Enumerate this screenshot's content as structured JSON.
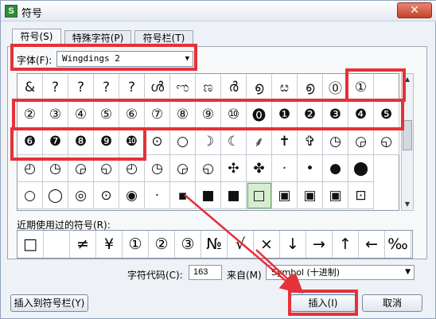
{
  "window": {
    "app_icon_letter": "S",
    "title": "符号",
    "close_glyph": "✕"
  },
  "tabs": [
    {
      "label": "符号(S)"
    },
    {
      "label": "特殊字符(P)"
    },
    {
      "label": "符号栏(T)"
    }
  ],
  "font": {
    "label": "字体(F):",
    "value": "Wingdings 2",
    "arrow": "▼"
  },
  "grid": {
    "rows": [
      [
        "&",
        "?",
        "?",
        "?",
        "?",
        "ൾ",
        "ಌ",
        "ಣ",
        "ർ",
        "൭",
        "ೞ",
        "൭",
        "⓪",
        "①"
      ],
      [
        "②",
        "③",
        "④",
        "⑤",
        "⑥",
        "⑦",
        "⑧",
        "⑨",
        "⑩",
        "⓿",
        "❶",
        "❷",
        "❸",
        "❹",
        "❺"
      ],
      [
        "❻",
        "❼",
        "❽",
        "❾",
        "❿",
        "⊙",
        "○",
        "☽",
        "☾",
        "⸙",
        "✝",
        "✞",
        "◷",
        "◶",
        "◵"
      ],
      [
        "◴",
        "◷",
        "◶",
        "◵",
        "◴",
        "◷",
        "◶",
        "◵",
        "✣",
        "✤",
        "·",
        "•",
        "●",
        "⬤"
      ],
      [
        "○",
        "◯",
        "◎",
        "⊙",
        "◉",
        "·",
        "▪",
        "■",
        "■",
        "□",
        "▣",
        "▣",
        "▣",
        "⊡"
      ]
    ]
  },
  "scrollbar": {
    "up": "▲",
    "down": "▼"
  },
  "recent": {
    "label": "近期使用过的符号(R):",
    "items": [
      "□",
      "",
      "≠",
      "¥",
      "①",
      "②",
      "③",
      "№",
      "√",
      "×",
      "↓",
      "→",
      "↑",
      "←",
      "‰"
    ]
  },
  "code": {
    "label": "字符代码(C):",
    "value": "163"
  },
  "from": {
    "label": "来自(M)",
    "value": "Symbol (十进制)",
    "arrow": "▼"
  },
  "buttons": {
    "insert_to_bar": "插入到符号栏(Y)",
    "insert": "插入(I)",
    "cancel": "取消"
  },
  "colors": {
    "annotation": "#e53138",
    "selected_cell": "#d8ecd2"
  }
}
